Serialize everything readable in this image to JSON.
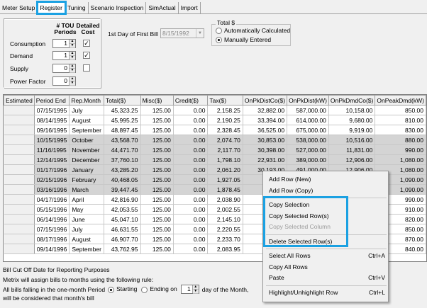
{
  "tabs": [
    {
      "label": "Meter Setup",
      "active": false
    },
    {
      "label": "Register",
      "active": true
    },
    {
      "label": "Tuning",
      "active": false
    },
    {
      "label": "Scenario Inspection",
      "active": false
    },
    {
      "label": "SimActual",
      "active": false
    },
    {
      "label": "Import",
      "active": false
    }
  ],
  "periods": {
    "header_tou": "# TOU\nPeriods",
    "header_cost": "Detailed\nCost",
    "rows": [
      {
        "label": "Consumption",
        "value": "1",
        "checked": true
      },
      {
        "label": "Demand",
        "value": "1",
        "checked": true
      },
      {
        "label": "Supply",
        "value": "0",
        "checked": false
      },
      {
        "label": "Power Factor",
        "value": "0",
        "checked": null
      }
    ]
  },
  "first_bill": {
    "label": "1st Day of First Bill",
    "value": "8/15/1992"
  },
  "total": {
    "title": "Total $",
    "options": [
      {
        "label": "Automatically Calculated",
        "selected": false
      },
      {
        "label": "Manually Entered",
        "selected": true
      }
    ]
  },
  "grid": {
    "columns": [
      "Estimated",
      "Period End",
      "Rep.Month",
      "Total($)",
      "Misc($)",
      "Credit($)",
      "Tax($)",
      "OnPkDistCo($)",
      "OnPkDist(kW)",
      "OnPkDmdCo($)",
      "OnPeakDmd(kW)"
    ],
    "rows": [
      {
        "sel": false,
        "c": [
          "",
          "07/15/1995",
          "July",
          "45,323.25",
          "125.00",
          "0.00",
          "2,158.25",
          "32,882.00",
          "587,000.00",
          "10,158.00",
          "850.00"
        ]
      },
      {
        "sel": false,
        "c": [
          "",
          "08/14/1995",
          "August",
          "45,995.25",
          "125.00",
          "0.00",
          "2,190.25",
          "33,394.00",
          "614,000.00",
          "9,680.00",
          "810.00"
        ]
      },
      {
        "sel": false,
        "c": [
          "",
          "09/16/1995",
          "September",
          "48,897.45",
          "125.00",
          "0.00",
          "2,328.45",
          "36,525.00",
          "675,000.00",
          "9,919.00",
          "830.00"
        ]
      },
      {
        "sel": true,
        "c": [
          "",
          "10/15/1995",
          "October",
          "43,568.70",
          "125.00",
          "0.00",
          "2,074.70",
          "30,853.00",
          "538,000.00",
          "10,516.00",
          "880.00"
        ]
      },
      {
        "sel": true,
        "c": [
          "",
          "11/16/1995",
          "November",
          "44,471.70",
          "125.00",
          "0.00",
          "2,117.70",
          "30,398.00",
          "527,000.00",
          "11,831.00",
          "990.00"
        ]
      },
      {
        "sel": true,
        "c": [
          "",
          "12/14/1995",
          "December",
          "37,760.10",
          "125.00",
          "0.00",
          "1,798.10",
          "22,931.00",
          "389,000.00",
          "12,906.00",
          "1,080.00"
        ]
      },
      {
        "sel": true,
        "c": [
          "",
          "01/17/1996",
          "January",
          "43,285.20",
          "125.00",
          "0.00",
          "2,061.20",
          "30,193.00",
          "491,000.00",
          "12,906.00",
          "1,080.00"
        ]
      },
      {
        "sel": true,
        "c": [
          "",
          "02/15/1996",
          "February",
          "40,468.05",
          "125.00",
          "0.00",
          "1,927.05",
          "",
          "",
          "",
          "1,090.00"
        ]
      },
      {
        "sel": true,
        "c": [
          "",
          "03/16/1996",
          "March",
          "39,447.45",
          "125.00",
          "0.00",
          "1,878.45",
          "",
          "",
          "",
          "1,090.00"
        ]
      },
      {
        "sel": false,
        "c": [
          "",
          "04/17/1996",
          "April",
          "42,816.90",
          "125.00",
          "0.00",
          "2,038.90",
          "",
          "",
          "",
          "990.00"
        ]
      },
      {
        "sel": false,
        "c": [
          "",
          "05/15/1996",
          "May",
          "42,053.55",
          "125.00",
          "0.00",
          "2,002.55",
          "",
          "",
          "",
          "910.00"
        ]
      },
      {
        "sel": false,
        "c": [
          "",
          "06/14/1996",
          "June",
          "45,047.10",
          "125.00",
          "0.00",
          "2,145.10",
          "",
          "",
          "",
          "820.00"
        ]
      },
      {
        "sel": false,
        "c": [
          "",
          "07/15/1996",
          "July",
          "46,631.55",
          "125.00",
          "0.00",
          "2,220.55",
          "",
          "",
          "",
          "850.00"
        ]
      },
      {
        "sel": false,
        "c": [
          "",
          "08/17/1996",
          "August",
          "46,907.70",
          "125.00",
          "0.00",
          "2,233.70",
          "",
          "",
          "",
          "870.00"
        ]
      },
      {
        "sel": false,
        "c": [
          "",
          "09/14/1996",
          "September",
          "43,762.95",
          "125.00",
          "0.00",
          "2,083.95",
          "",
          "",
          "",
          "840.00"
        ]
      }
    ]
  },
  "cutoff": {
    "title": "Bill Cut Off Date for Reporting Purposes",
    "line1": "Metrix will assign bills to months using the following rule:",
    "line2": "All bills falling in the one-month Period",
    "opt_start": "Starting",
    "opt_end": "Ending on",
    "day": "1",
    "day_suffix": "day of the Month,",
    "line3": "will be considered that month's bill"
  },
  "context_menu": [
    {
      "label": "Add Row (New)",
      "shortcut": "",
      "disabled": false,
      "sep_after": false
    },
    {
      "label": "Add Row (Copy)",
      "shortcut": "",
      "disabled": false,
      "sep_after": true
    },
    {
      "label": "Copy Selection",
      "shortcut": "",
      "disabled": false,
      "sep_after": false
    },
    {
      "label": "Copy Selected Row(s)",
      "shortcut": "",
      "disabled": false,
      "sep_after": false
    },
    {
      "label": "Copy Selected Column",
      "shortcut": "",
      "disabled": true,
      "sep_after": true
    },
    {
      "label": "Delete Selected Row(s)",
      "shortcut": "",
      "disabled": false,
      "sep_after": true
    },
    {
      "label": "Select All Rows",
      "shortcut": "Ctrl+A",
      "disabled": false,
      "sep_after": false
    },
    {
      "label": "Copy All Rows",
      "shortcut": "",
      "disabled": false,
      "sep_after": false
    },
    {
      "label": "Paste",
      "shortcut": "Ctrl+V",
      "disabled": false,
      "sep_after": true
    },
    {
      "label": "Highlight/Unhighlight Row",
      "shortcut": "Ctrl+L",
      "disabled": false,
      "sep_after": false
    }
  ],
  "colors": {
    "highlight": "#1ba1e2",
    "selected_row": "#d4d4d4"
  }
}
